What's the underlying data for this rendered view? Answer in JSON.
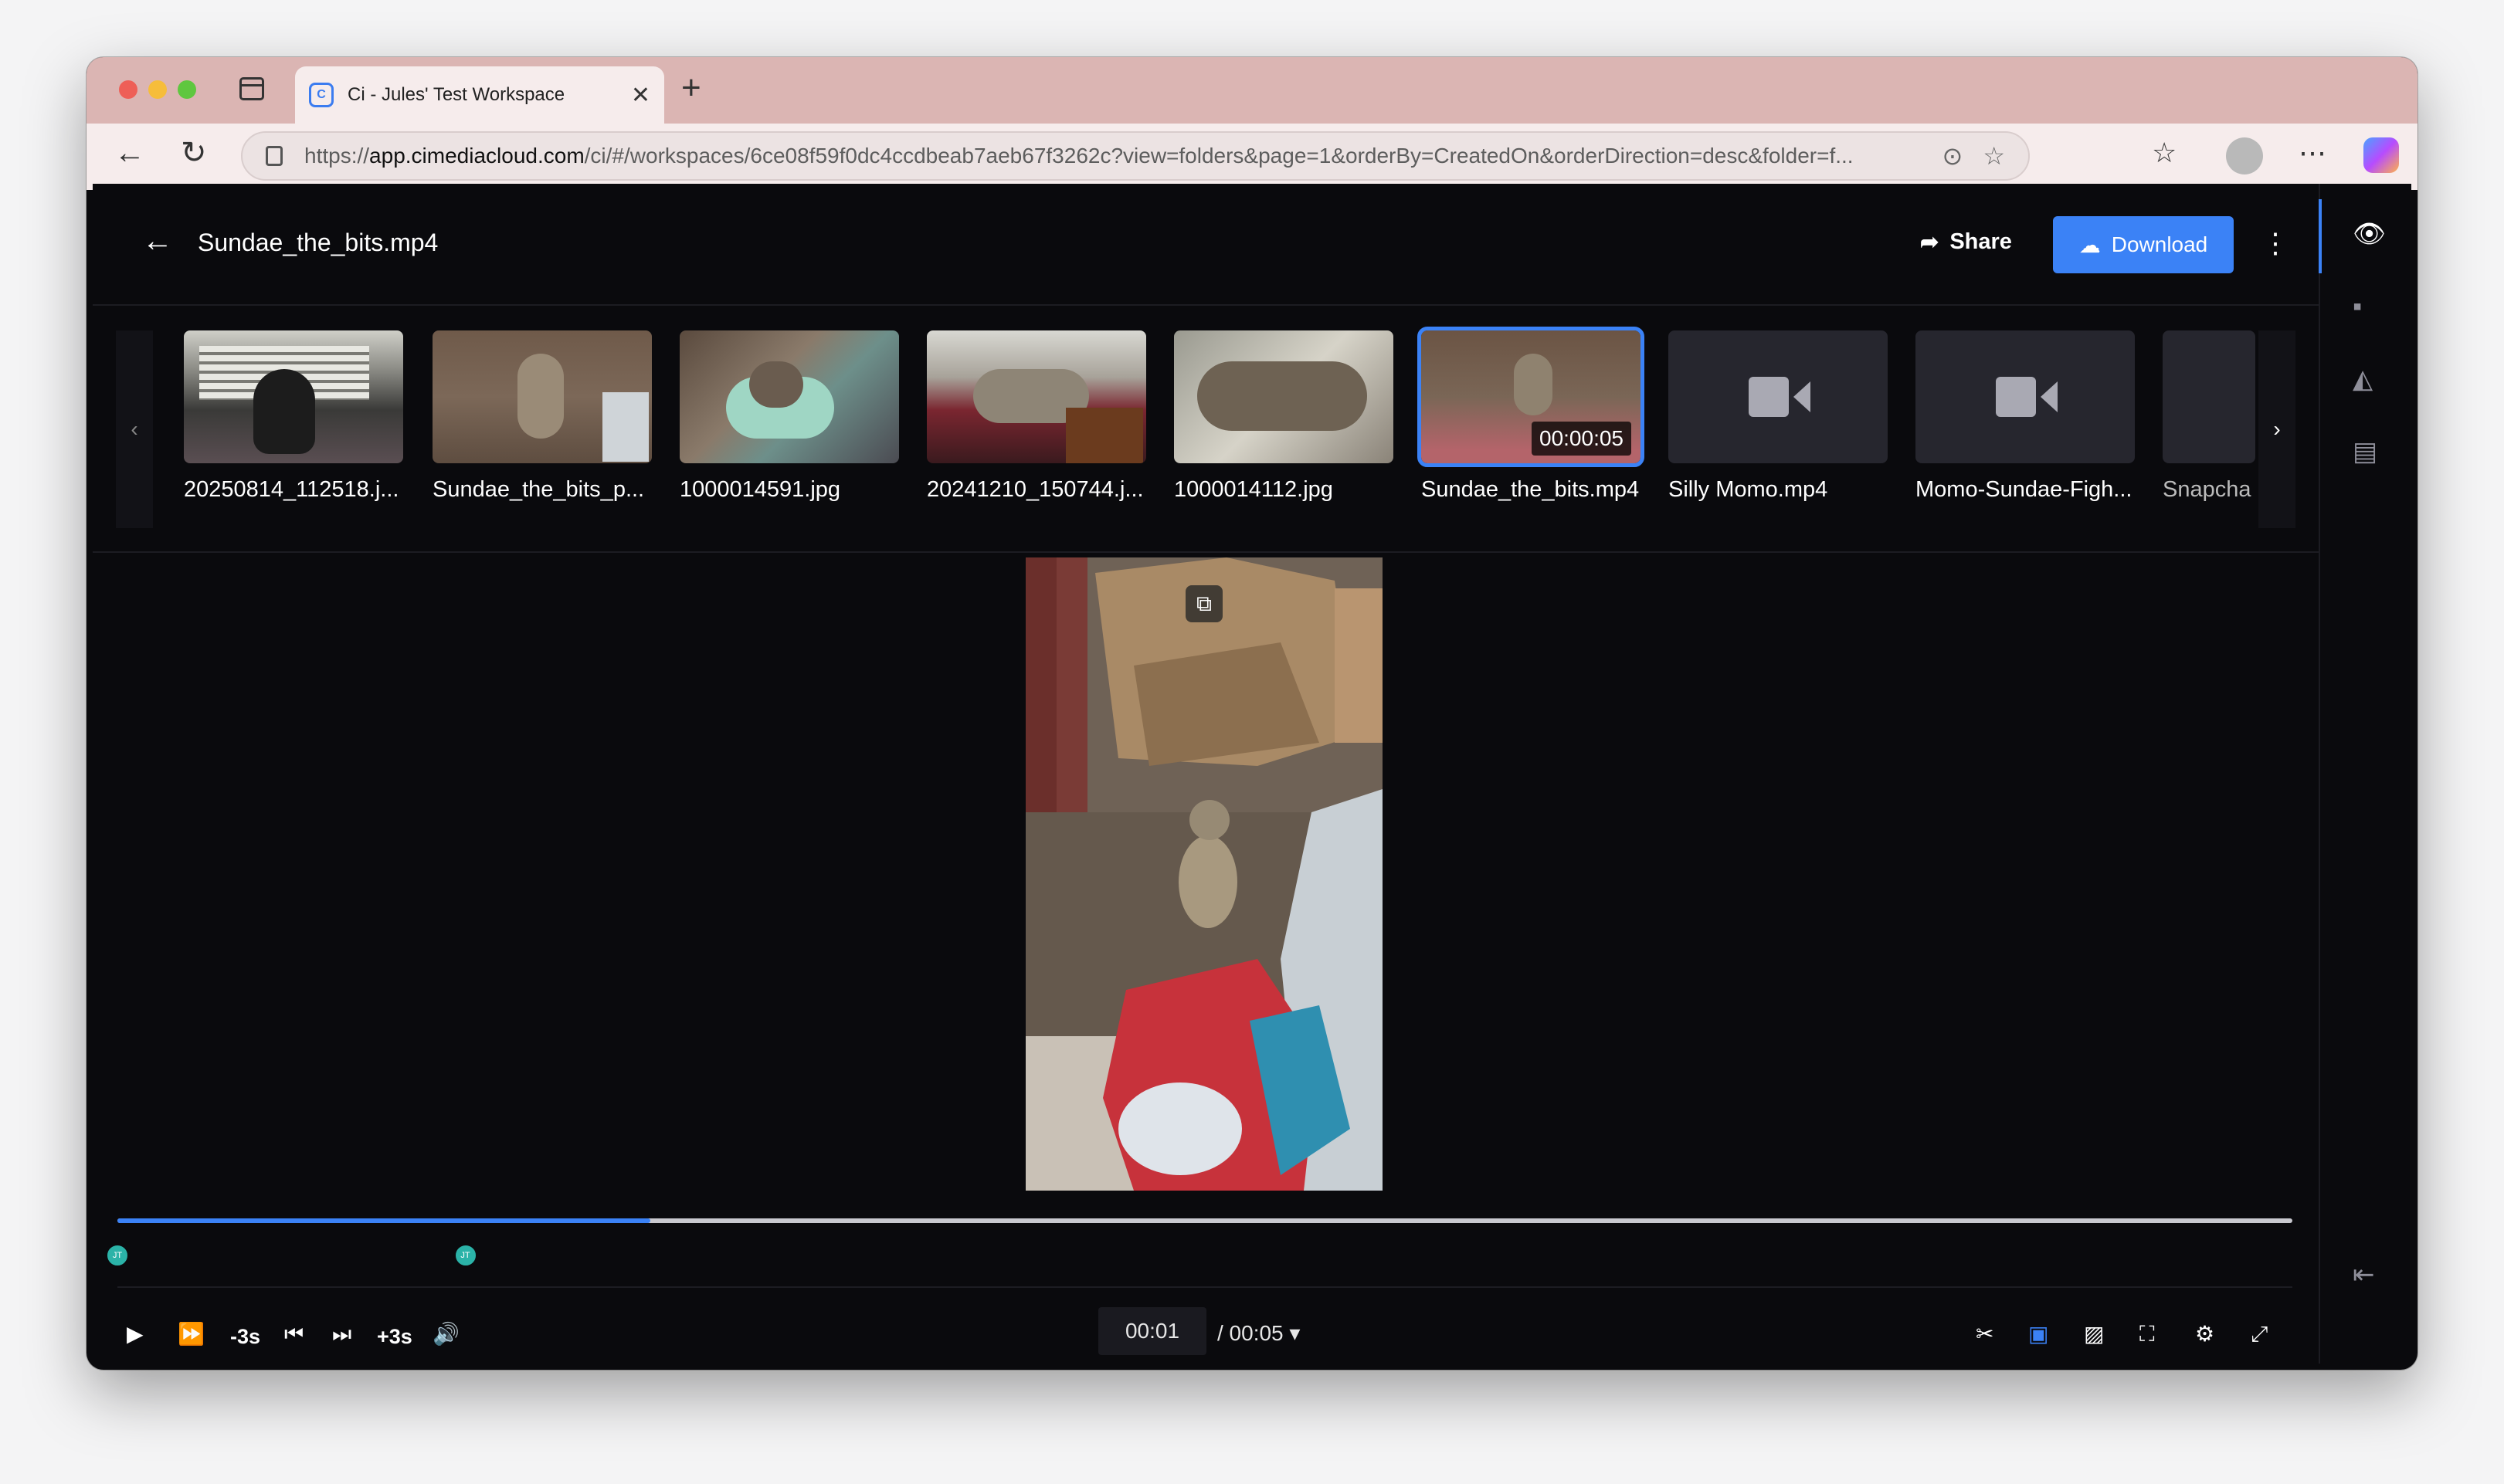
{
  "browser": {
    "tab_title": "Ci - Jules' Test Workspace",
    "tab_favicon": "C",
    "url_prefix": "https://",
    "url_host": "app.cimediacloud.com",
    "url_path": "/ci/#/workspaces/6ce08f59f0dc4ccdbeab7aeb67f3262c?view=folders&page=1&orderBy=CreatedOn&orderDirection=desc&folder=f..."
  },
  "header": {
    "filename": "Sundae_the_bits.mp4",
    "share_label": "Share",
    "download_label": "Download"
  },
  "filmstrip": [
    {
      "name": "20250814_112518.j...",
      "kind": "image"
    },
    {
      "name": "Sundae_the_bits_p...",
      "kind": "image"
    },
    {
      "name": "1000014591.jpg",
      "kind": "image"
    },
    {
      "name": "20241210_150744.j...",
      "kind": "image"
    },
    {
      "name": "1000014112.jpg",
      "kind": "image"
    },
    {
      "name": "Sundae_the_bits.mp4",
      "kind": "video",
      "duration": "00:00:05",
      "selected": true
    },
    {
      "name": "Silly Momo.mp4",
      "kind": "video"
    },
    {
      "name": "Momo-Sundae-Figh...",
      "kind": "video"
    },
    {
      "name": "Snapcha",
      "kind": "video"
    }
  ],
  "player": {
    "progress": 0.245,
    "current_time": "00:01",
    "duration": "/ 00:05",
    "rewind_label": "-3s",
    "forward_label": "+3s",
    "comment_markers": [
      {
        "initials": "JT",
        "time_fraction": 0.0
      },
      {
        "initials": "JT",
        "time_fraction": 0.16
      }
    ]
  },
  "colors": {
    "accent": "#3b82f6",
    "background": "#0a0a0d",
    "marker": "#2bb3a8"
  }
}
